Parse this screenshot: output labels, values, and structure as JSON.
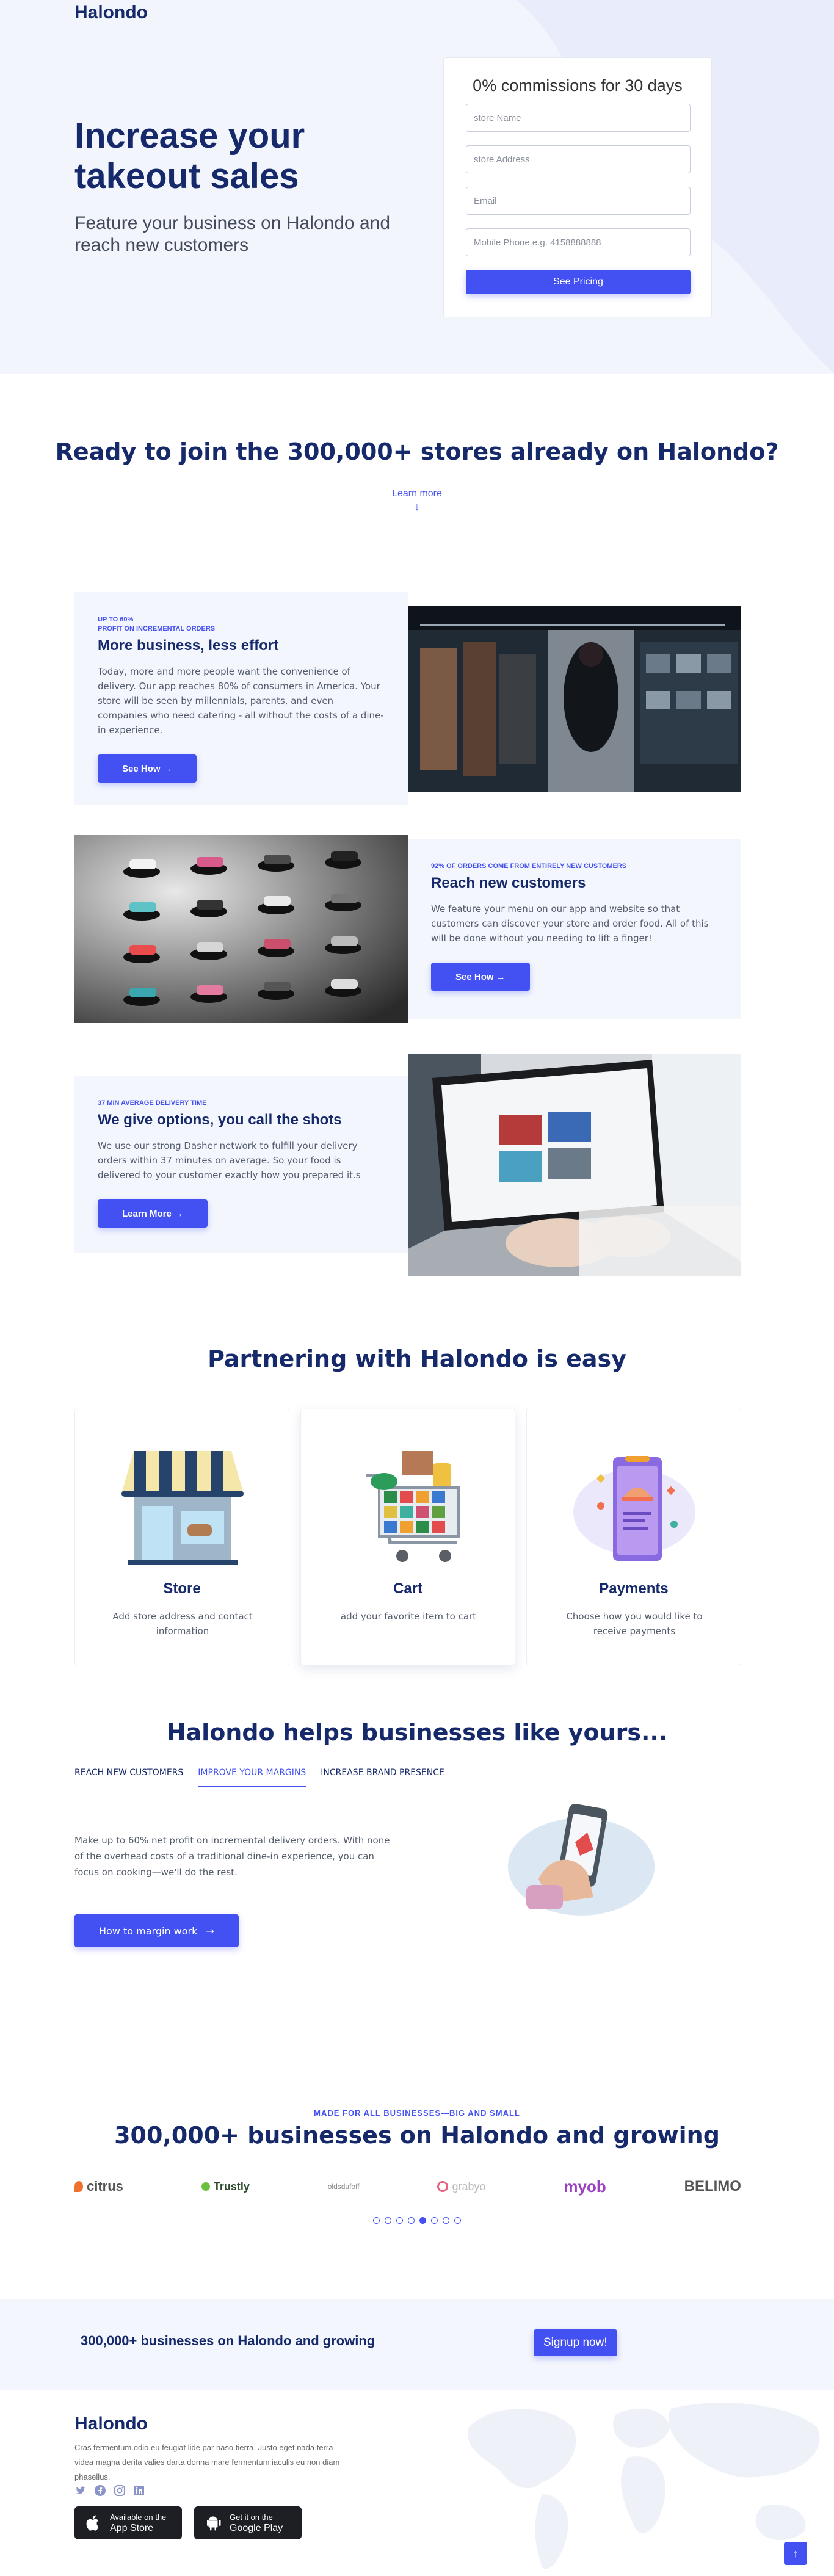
{
  "brand": "Halondo",
  "hero": {
    "title": "Increase your takeout sales",
    "subtitle": "Feature your business on Halondo and reach new customers",
    "form": {
      "heading": "0% commissions for 30 days",
      "store_name_placeholder": "store Name",
      "store_address_placeholder": "store Address",
      "email_placeholder": "Email",
      "phone_placeholder": "Mobile Phone e.g. 4158888888",
      "submit_label": "See Pricing"
    }
  },
  "ready": {
    "title": "Ready to join the 300,000+ stores already on Halondo?",
    "learn_more": "Learn more",
    "arrow": "↓"
  },
  "features": [
    {
      "kicker_line1": "UP TO 60%",
      "kicker_line2": "PROFIT ON INCREMENTAL ORDERS",
      "title": "More business, less effort",
      "body": "Today, more and more people want the convenience of delivery. Our app reaches 80% of consumers in America. Your store will be seen by millennials, parents, and even companies who need catering - all without the costs of a dine-in experience.",
      "button": "See How →"
    },
    {
      "kicker_line1": "92% OF ORDERS COME FROM ENTIRELY NEW CUSTOMERS",
      "title": "Reach new customers",
      "body": "We feature your menu on our app and website so that customers can discover your store and order food. All of this will be done without you needing to lift a finger!",
      "button": "See How →"
    },
    {
      "kicker_line1": "37 MIN AVERAGE DELIVERY TIME",
      "title": "We give options, you call the shots",
      "body": "We use our strong Dasher network to fulfill your delivery orders within 37 minutes on average. So your food is delivered to your customer exactly how you prepared it.s",
      "button": "Learn More →"
    }
  ],
  "partner": {
    "title": "Partnering with Halondo is easy",
    "cards": [
      {
        "title": "Store",
        "desc": "Add store address and contact information",
        "icon": "store-icon"
      },
      {
        "title": "Cart",
        "desc": "add your favorite item to cart",
        "icon": "cart-icon"
      },
      {
        "title": "Payments",
        "desc": "Choose how you would like to receive payments",
        "icon": "payments-icon"
      }
    ]
  },
  "helps": {
    "title": "Halondo helps businesses like yours...",
    "tabs": [
      "REACH NEW CUSTOMERS",
      "IMPROVE YOUR MARGINS",
      "INCREASE BRAND PRESENCE"
    ],
    "active_tab": 1,
    "text": "Make up to 60% net profit on incremental delivery orders. With none of the overhead costs of a traditional dine-in experience, you can focus on cooking—we'll do the rest.",
    "button": "How to margin work",
    "button_arrow": "→"
  },
  "businesses": {
    "kicker": "MADE FOR ALL BUSINESSES—BIG AND SMALL",
    "title": "300,000+ businesses on Halondo and growing",
    "logos": [
      "citrus",
      "Trustly",
      "oldsdufoff",
      "grabyo",
      "myob",
      "BELIMO"
    ],
    "active_dot": 4,
    "dot_count": 8
  },
  "signup_bar": {
    "title": "300,000+ businesses on Halondo and growing",
    "button": "Signup now!"
  },
  "footer": {
    "logo": "Halondo",
    "text": "Cras fermentum odio eu feugiat lide par naso tierra. Justo eget nada terra videa magna derita valies darta donna mare fermentum iaculis eu non diam phasellus.",
    "app_store_small": "Available on the",
    "app_store_big": "App Store",
    "google_small": "Get it on the",
    "google_big": "Google Play",
    "to_top": "↑"
  },
  "colors": {
    "brand_navy": "#16296b",
    "accent": "#4451f2",
    "panel_bg": "#f3f6fd"
  }
}
